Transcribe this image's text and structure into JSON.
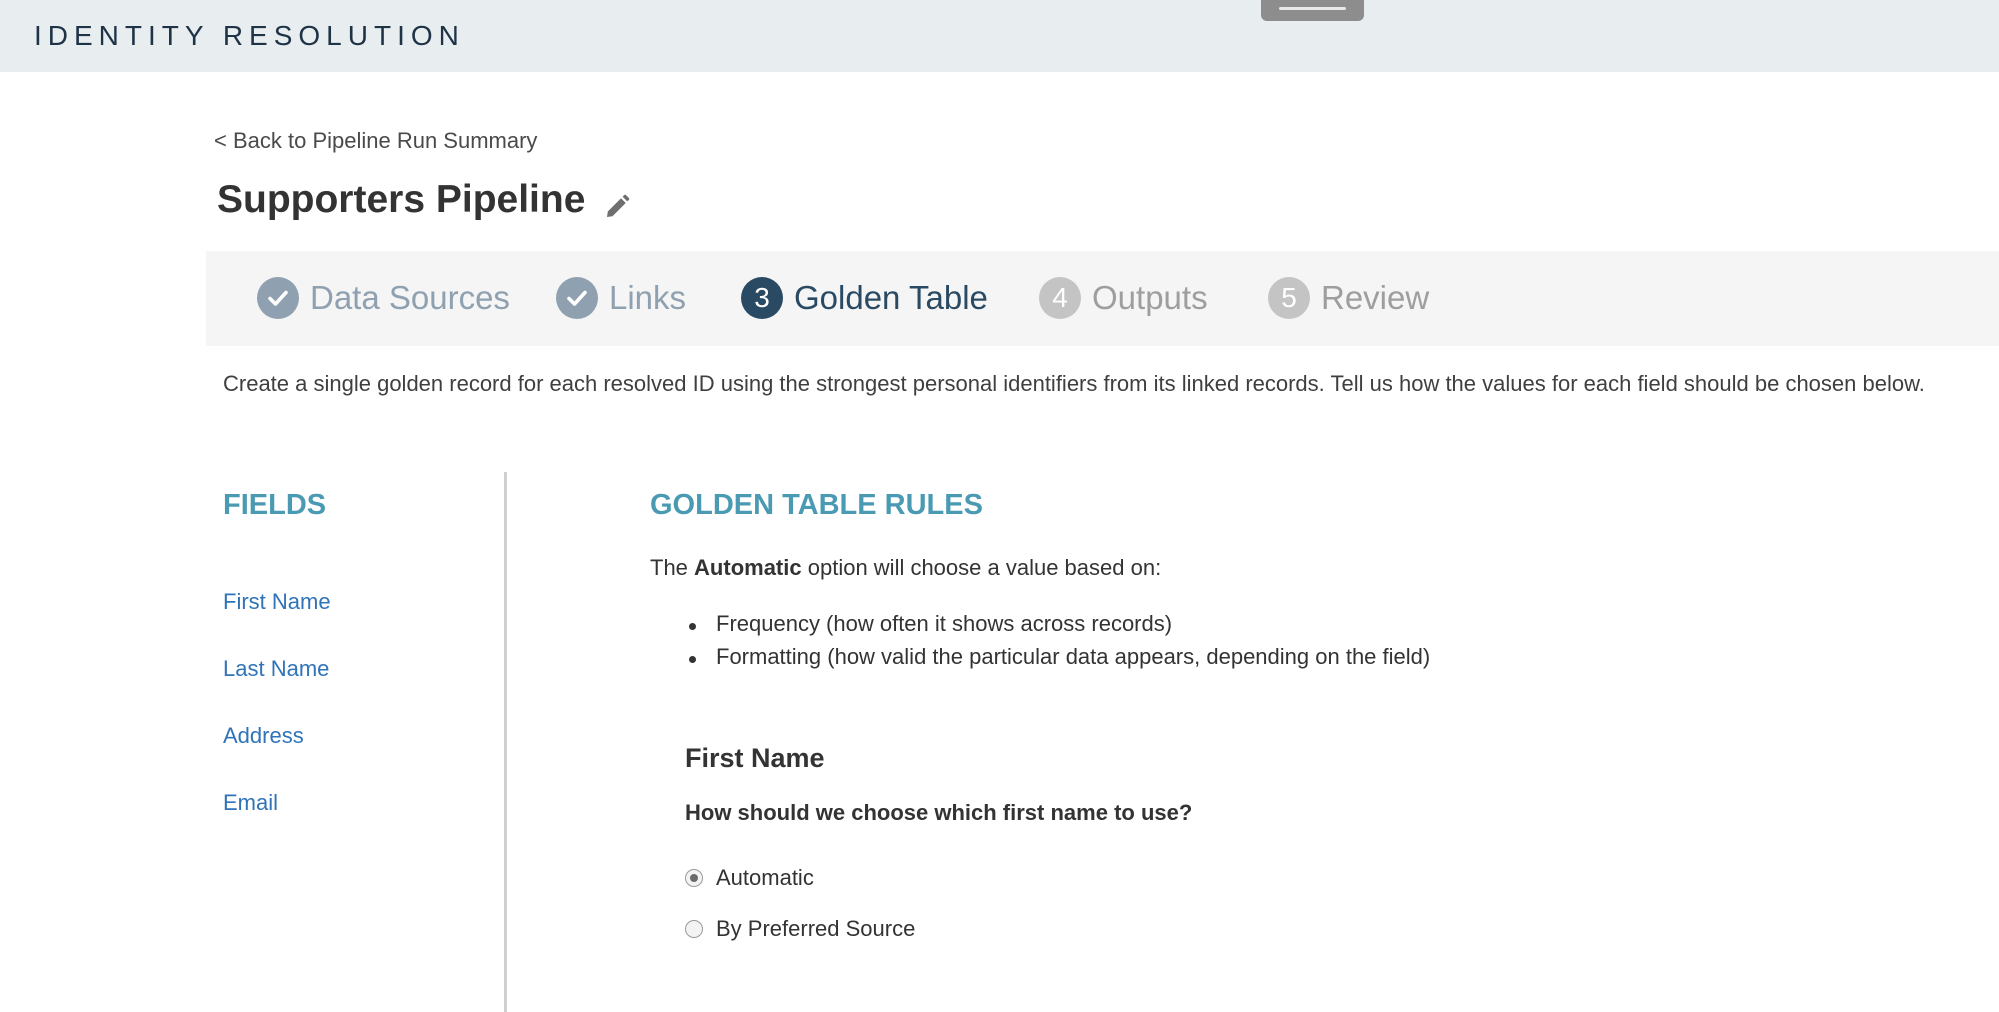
{
  "app": {
    "title": "IDENTITY RESOLUTION"
  },
  "nav": {
    "back_label": "< Back to Pipeline Run Summary"
  },
  "page": {
    "title": "Supporters Pipeline"
  },
  "stepper": {
    "steps": [
      {
        "number": "1",
        "label": "Data Sources",
        "state": "complete"
      },
      {
        "number": "2",
        "label": "Links",
        "state": "complete"
      },
      {
        "number": "3",
        "label": "Golden Table",
        "state": "active"
      },
      {
        "number": "4",
        "label": "Outputs",
        "state": "upcoming"
      },
      {
        "number": "5",
        "label": "Review",
        "state": "upcoming"
      }
    ]
  },
  "description": "Create a single golden record for each resolved ID using the strongest personal identifiers from its linked records. Tell us how the values for each field should be chosen below.",
  "fields": {
    "heading": "FIELDS",
    "items": [
      "First Name",
      "Last Name",
      "Address",
      "Email"
    ]
  },
  "rules": {
    "heading": "GOLDEN TABLE RULES",
    "intro_prefix": "The",
    "intro_bold": "Automatic",
    "intro_suffix": "option will choose a value based on:",
    "bullets": [
      "Frequency (how often it shows across records)",
      "Formatting (how valid the particular data appears, depending on the field)"
    ],
    "section": {
      "title": "First Name",
      "question": "How should we choose which first name to use?",
      "options": [
        {
          "label": "Automatic",
          "selected": true
        },
        {
          "label": "By Preferred Source",
          "selected": false
        }
      ]
    }
  },
  "colors": {
    "accent_heading": "#4a9ab3",
    "link": "#2f73b8",
    "step_active": "#2a4a63",
    "step_complete": "#8fa0b0",
    "step_upcoming": "#c4c4c4"
  },
  "icons": {
    "edit": "pencil-icon",
    "step_complete": "check-icon"
  }
}
